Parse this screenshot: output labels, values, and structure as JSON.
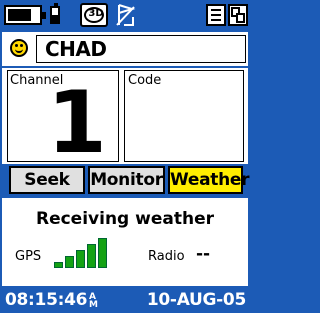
{
  "status_bar": {
    "battery_level": 0.75,
    "external_battery_level": 0.5,
    "fix_mode_label": "3D",
    "icons": [
      "battery-icon",
      "external-battery-icon",
      "3d-fix-icon",
      "weather-alert-icon",
      "menu-icon",
      "pages-icon"
    ]
  },
  "contact": {
    "icon": "smiley-face-icon",
    "name": "CHAD"
  },
  "channel": {
    "label": "Channel",
    "value": "1"
  },
  "code": {
    "label": "Code",
    "value": ""
  },
  "buttons": {
    "seek": "Seek",
    "monitor": "Monitor",
    "weather": "Weather",
    "active": "weather"
  },
  "status": {
    "message": "Receiving weather",
    "gps_label": "GPS",
    "gps_bars_filled": 5,
    "gps_bars_total": 5,
    "radio_label": "Radio",
    "radio_value": "--"
  },
  "footer": {
    "time": "08:15:46",
    "ampm_top": "A",
    "ampm_bottom": "M",
    "date": "10-AUG-05"
  },
  "colors": {
    "frame_blue": "#1c5bb6",
    "active_button": "#ffee00",
    "signal_green": "#14a214",
    "face_yellow": "#ffd800"
  }
}
